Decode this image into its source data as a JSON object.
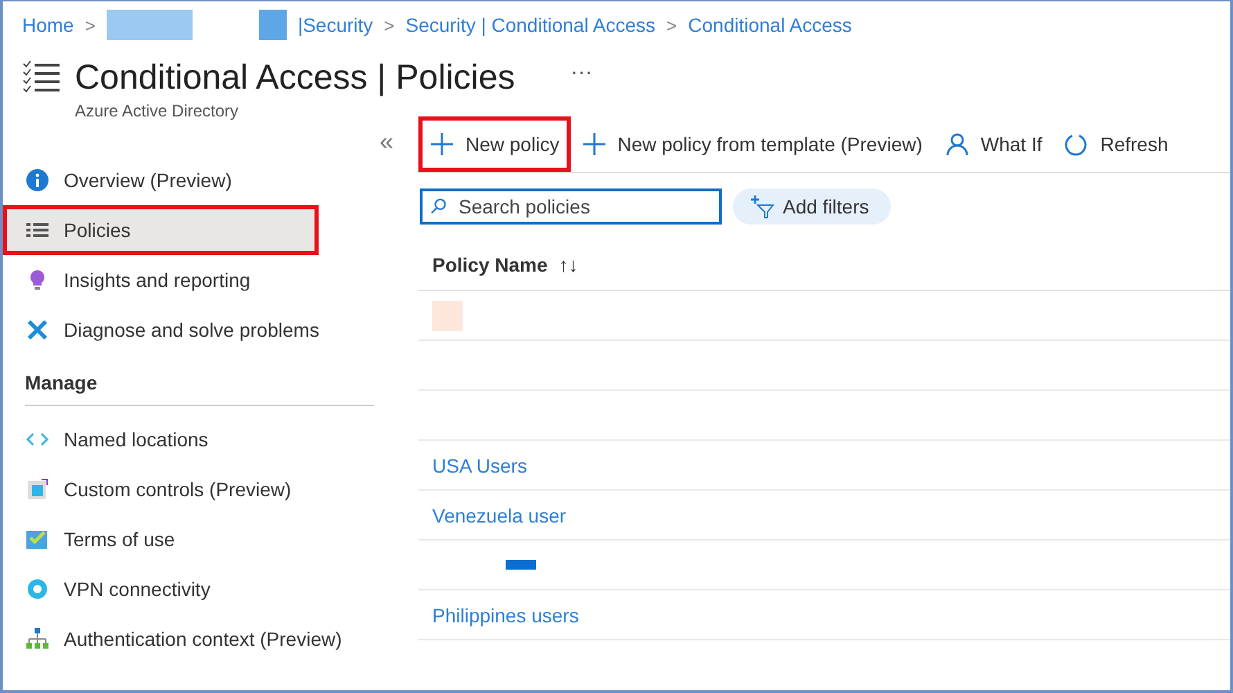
{
  "breadcrumb": [
    {
      "label": "Home",
      "kind": "link",
      "separator": ">"
    },
    {
      "kind": "redacted",
      "color": "#9cc9ef"
    },
    {
      "kind": "redacted",
      "color": "#5ea7e6"
    },
    {
      "label": "|Security",
      "kind": "link",
      "separator": ">"
    },
    {
      "label": "Security | Conditional Access",
      "kind": "link",
      "separator": ">"
    },
    {
      "label": "Conditional Access",
      "kind": "link"
    }
  ],
  "header": {
    "title": "Conditional Access | Policies",
    "subtitle": "Azure Active Directory",
    "more": "···"
  },
  "sidebar": {
    "collapse": "«",
    "items": [
      {
        "label": "Overview (Preview)",
        "selected": false,
        "highlighted": false
      },
      {
        "label": "Policies",
        "selected": true,
        "highlighted": true
      },
      {
        "label": "Insights and reporting",
        "selected": false,
        "highlighted": false
      },
      {
        "label": "Diagnose and solve problems",
        "selected": false,
        "highlighted": false
      }
    ],
    "section": "Manage",
    "manage_items": [
      {
        "label": "Named locations",
        "selected": false,
        "highlighted": false
      },
      {
        "label": "Custom controls (Preview)",
        "selected": false,
        "highlighted": false
      },
      {
        "label": "Terms of use",
        "selected": false,
        "highlighted": false
      },
      {
        "label": "VPN connectivity",
        "selected": false,
        "highlighted": false
      },
      {
        "label": "Authentication context (Preview)",
        "selected": false,
        "highlighted": false
      }
    ]
  },
  "toolbar": [
    {
      "label": "New policy",
      "highlighted": true
    },
    {
      "label": "New policy from template (Preview)",
      "highlighted": false
    },
    {
      "label": "What If",
      "highlighted": false
    },
    {
      "label": "Refresh",
      "highlighted": false
    }
  ],
  "search": {
    "placeholder": "Search policies"
  },
  "filter_button": "Add filters",
  "table": {
    "columns": [
      {
        "label": "Policy Name",
        "sort": "↑↓"
      }
    ],
    "rows": [
      {
        "kind": "redacted",
        "color": "#fde7dd"
      },
      {
        "kind": "blank"
      },
      {
        "kind": "blank"
      },
      {
        "kind": "link",
        "name": "USA Users"
      },
      {
        "kind": "link",
        "name": "Venezuela user"
      },
      {
        "kind": "redacted",
        "color": "#0a6fd0"
      },
      {
        "kind": "link",
        "name": "Philippines users"
      }
    ]
  }
}
